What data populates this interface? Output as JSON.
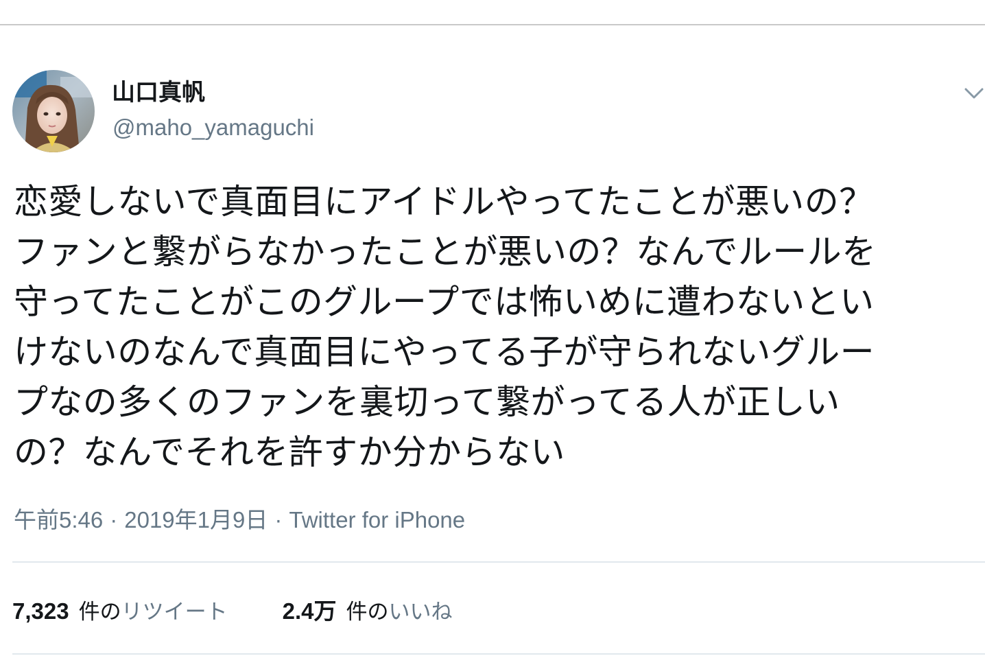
{
  "tweet": {
    "display_name": "山口真帆",
    "handle": "@maho_yamaguchi",
    "menu_icon": "chevron-down-icon",
    "text_lines": [
      "恋愛しないで真面目にアイドルやってたことが悪いの？",
      "ファンと繋がらなかったことが悪いの？なんでルールを",
      "守ってたことがこのグループでは怖いめに遭わないとい",
      "けないのなんで真面目にやってる子が守られないグルー",
      "プなの多くのファンを裏切って繋がってる人が正しい",
      "の？なんでそれを許すか分からない"
    ],
    "time": "午前5:46",
    "date": "2019年1月9日",
    "separator": "·",
    "source": "Twitter for iPhone"
  },
  "stats": {
    "retweets": {
      "count": "7,323",
      "unit": "件",
      "particle": "の",
      "label": "リツイート"
    },
    "likes": {
      "count": "2.4万",
      "unit": "件",
      "particle": "の",
      "label": "いいね"
    }
  },
  "colors": {
    "text_primary": "#14171a",
    "text_secondary": "#657786",
    "divider": "#e1e8ed"
  }
}
